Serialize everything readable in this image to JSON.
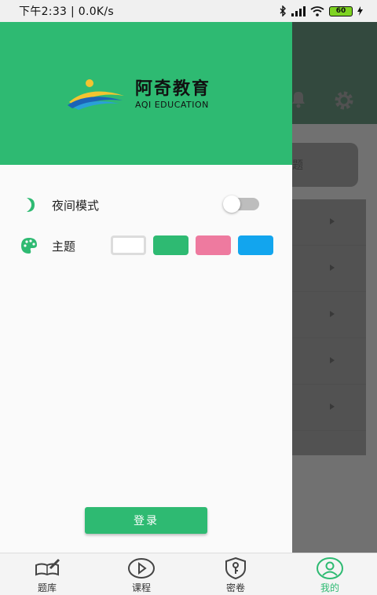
{
  "status_bar": {
    "time_speed": "下午2:33 | 0.0K/s",
    "battery": "60"
  },
  "background": {
    "card_text": "题"
  },
  "drawer": {
    "logo": {
      "cn": "阿奇教育",
      "en": "AQI EDUCATION"
    },
    "night_mode": {
      "label": "夜间模式",
      "enabled": false
    },
    "theme": {
      "label": "主题",
      "colors": [
        "#ffffff",
        "#2eba72",
        "#ee7a9f",
        "#12a5ee"
      ]
    },
    "login_button": "登录"
  },
  "bottom_nav": [
    {
      "label": "题库",
      "icon": "book-pen-icon",
      "active": false
    },
    {
      "label": "课程",
      "icon": "play-icon",
      "active": false
    },
    {
      "label": "密卷",
      "icon": "shield-key-icon",
      "active": false
    },
    {
      "label": "我的",
      "icon": "user-icon",
      "active": true
    }
  ],
  "colors": {
    "accent": "#2eba72",
    "dark_header": "#1f6b45"
  }
}
